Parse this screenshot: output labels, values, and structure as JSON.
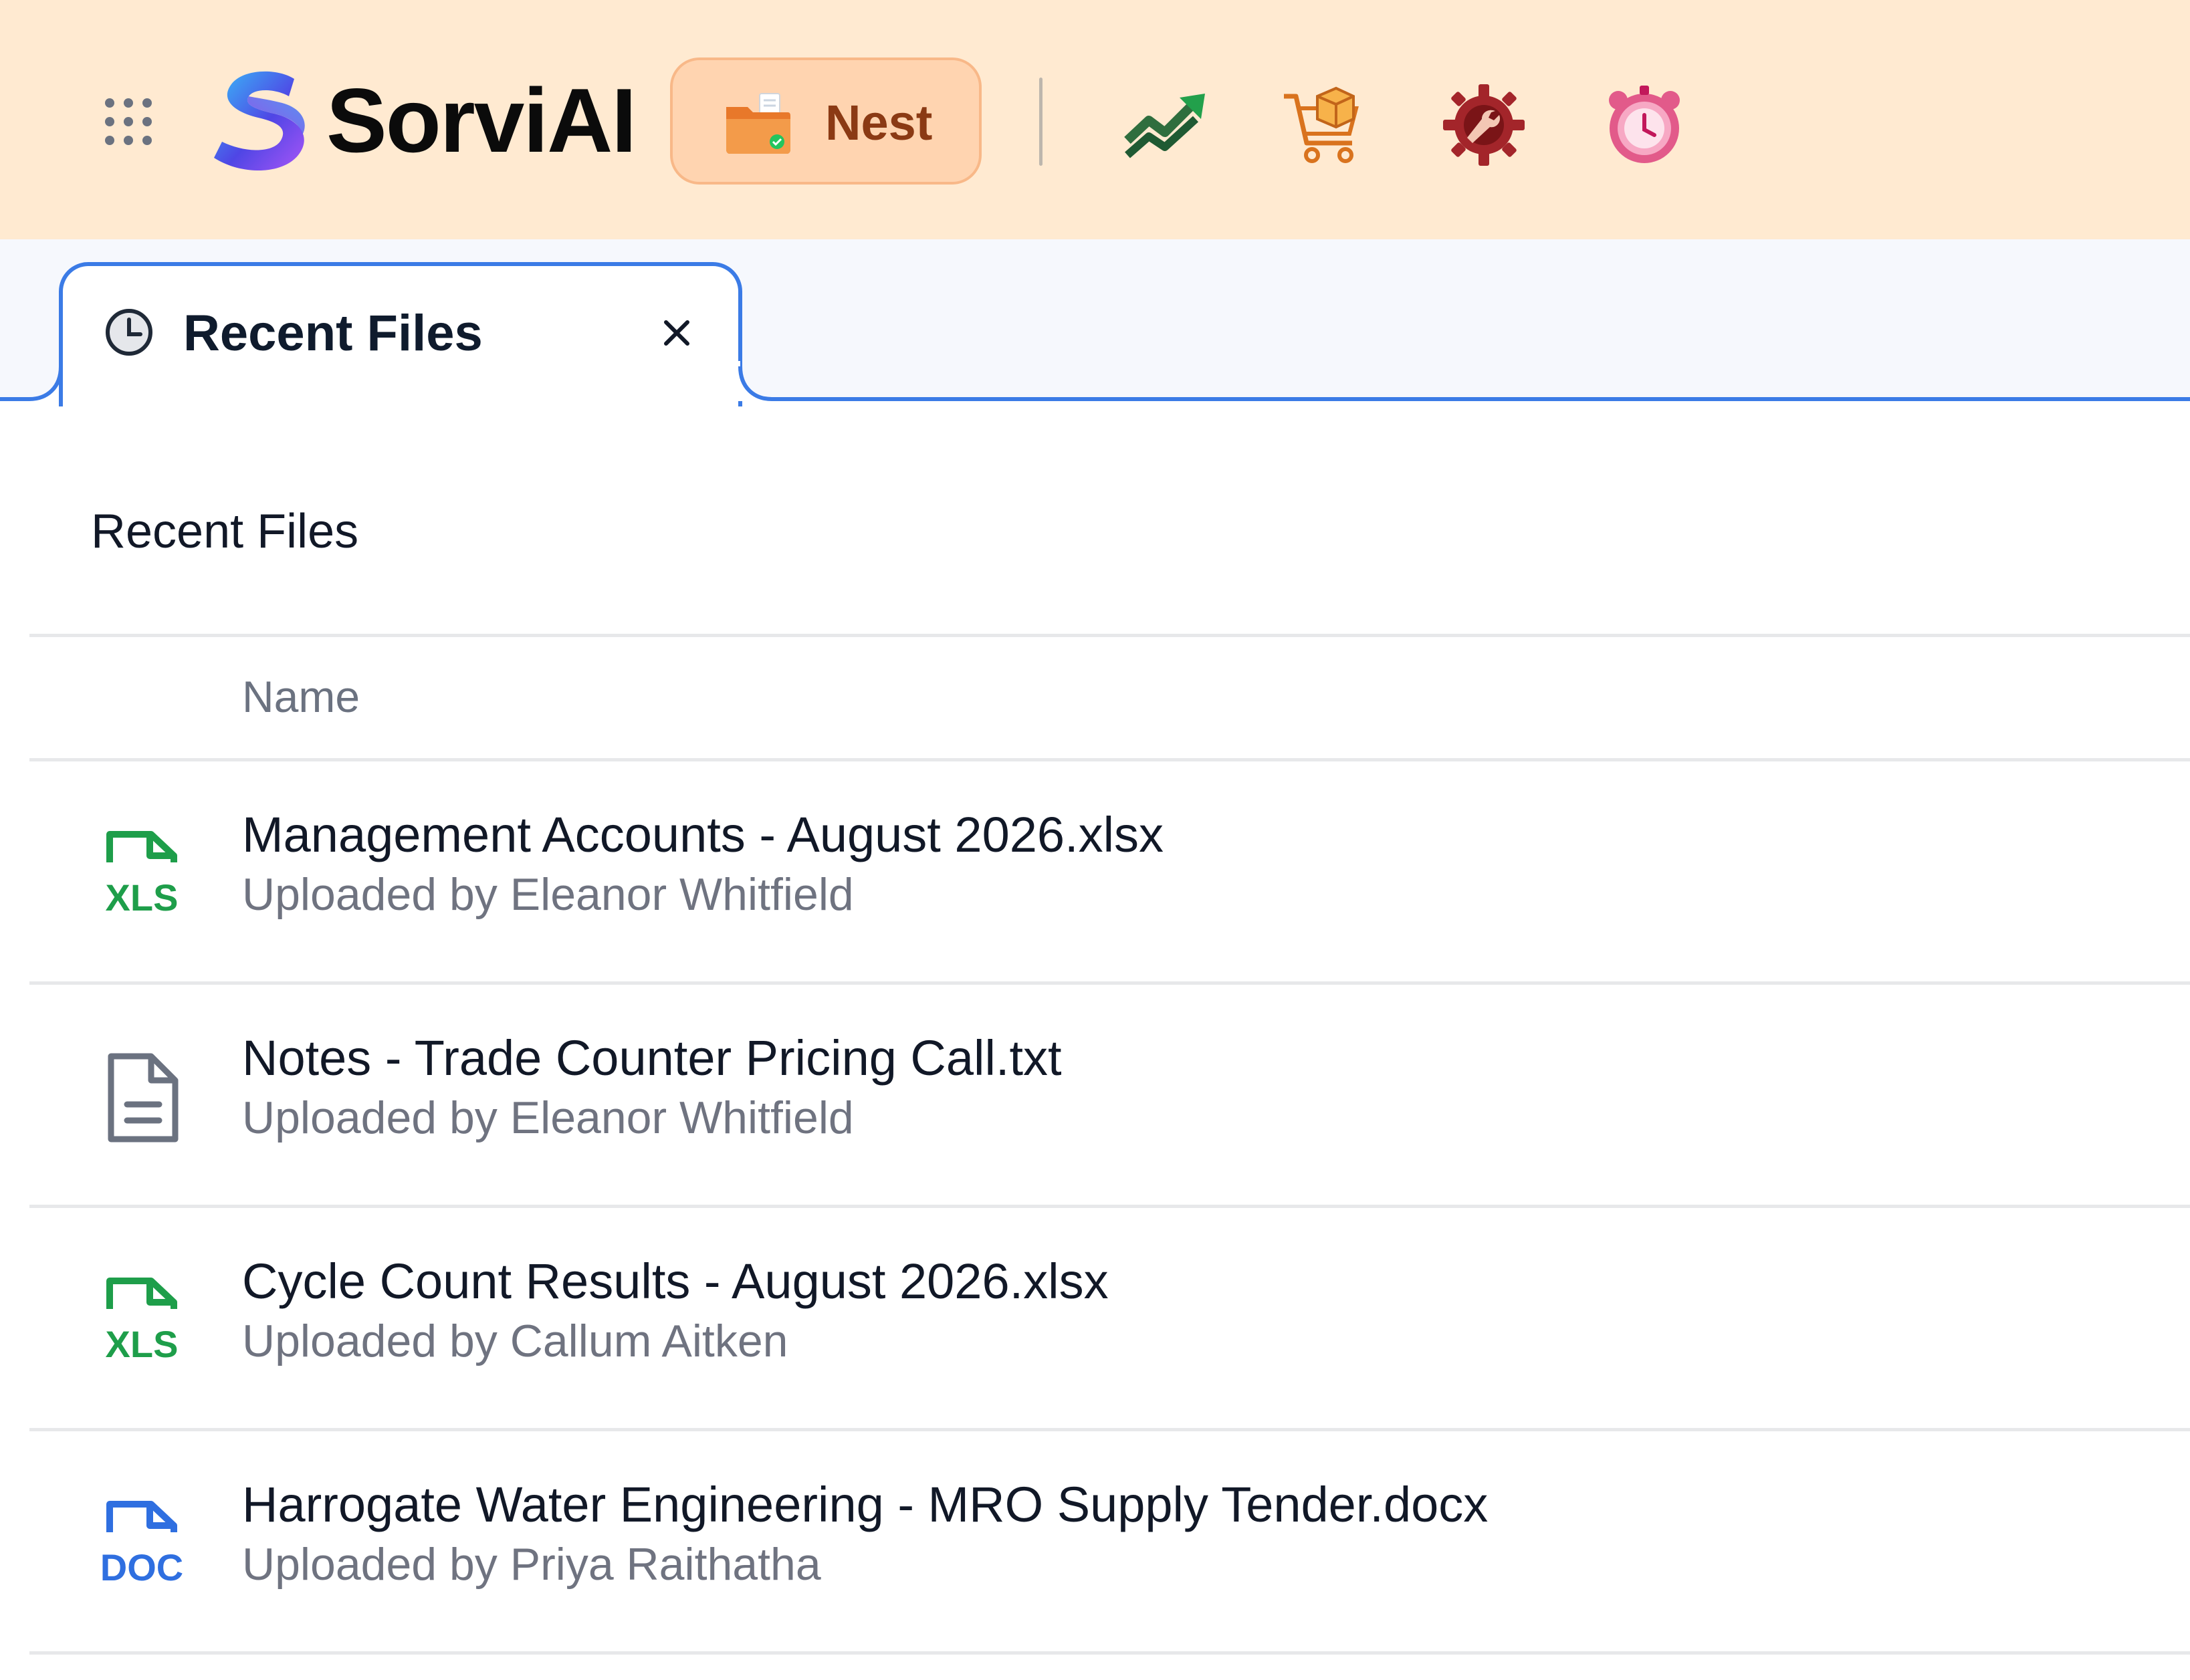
{
  "header": {
    "brand": "SorviAI",
    "active_app_label": "Nest",
    "apps": [
      {
        "icon": "trend-up-arrow-icon"
      },
      {
        "icon": "shopping-cart-box-icon"
      },
      {
        "icon": "gear-wrench-icon"
      },
      {
        "icon": "alarm-clock-icon"
      }
    ]
  },
  "tab": {
    "title": "Recent Files",
    "icon": "clock-icon"
  },
  "main": {
    "section_title": "Recent Files",
    "column_header": "Name",
    "files": [
      {
        "type": "XLS",
        "name": "Management Accounts - August 2026.xlsx",
        "uploaded": "Uploaded by Eleanor Whitfield"
      },
      {
        "type": "TXT",
        "name": "Notes - Trade Counter Pricing Call.txt",
        "uploaded": "Uploaded by Eleanor Whitfield"
      },
      {
        "type": "XLS",
        "name": "Cycle Count Results - August 2026.xlsx",
        "uploaded": "Uploaded by Callum Aitken"
      },
      {
        "type": "DOC",
        "name": "Harrogate Water Engineering - MRO Supply Tender.docx",
        "uploaded": "Uploaded by Priya Raithatha"
      }
    ]
  },
  "colors": {
    "header_bg": "#FFEAD1",
    "nest_bg": "#FFD4B0",
    "nest_text": "#8B3A14",
    "tab_accent": "#3B7BE6",
    "xls_green": "#1E9E4A",
    "doc_blue": "#2F6FE0",
    "txt_gray": "#6b7280"
  }
}
